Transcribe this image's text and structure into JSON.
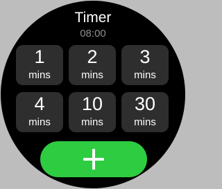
{
  "app": {
    "title": "Timer",
    "current_time": "08:00"
  },
  "presets": [
    {
      "value": "1",
      "unit": "mins"
    },
    {
      "value": "2",
      "unit": "mins"
    },
    {
      "value": "3",
      "unit": "mins"
    },
    {
      "value": "4",
      "unit": "mins"
    },
    {
      "value": "10",
      "unit": "mins"
    },
    {
      "value": "30",
      "unit": "mins"
    }
  ],
  "add_button": {
    "icon": "plus-icon"
  },
  "colors": {
    "background": "#000000",
    "tile": "#2e2e2e",
    "accent": "#2ecc40",
    "subtitle": "#8e8e8e"
  }
}
